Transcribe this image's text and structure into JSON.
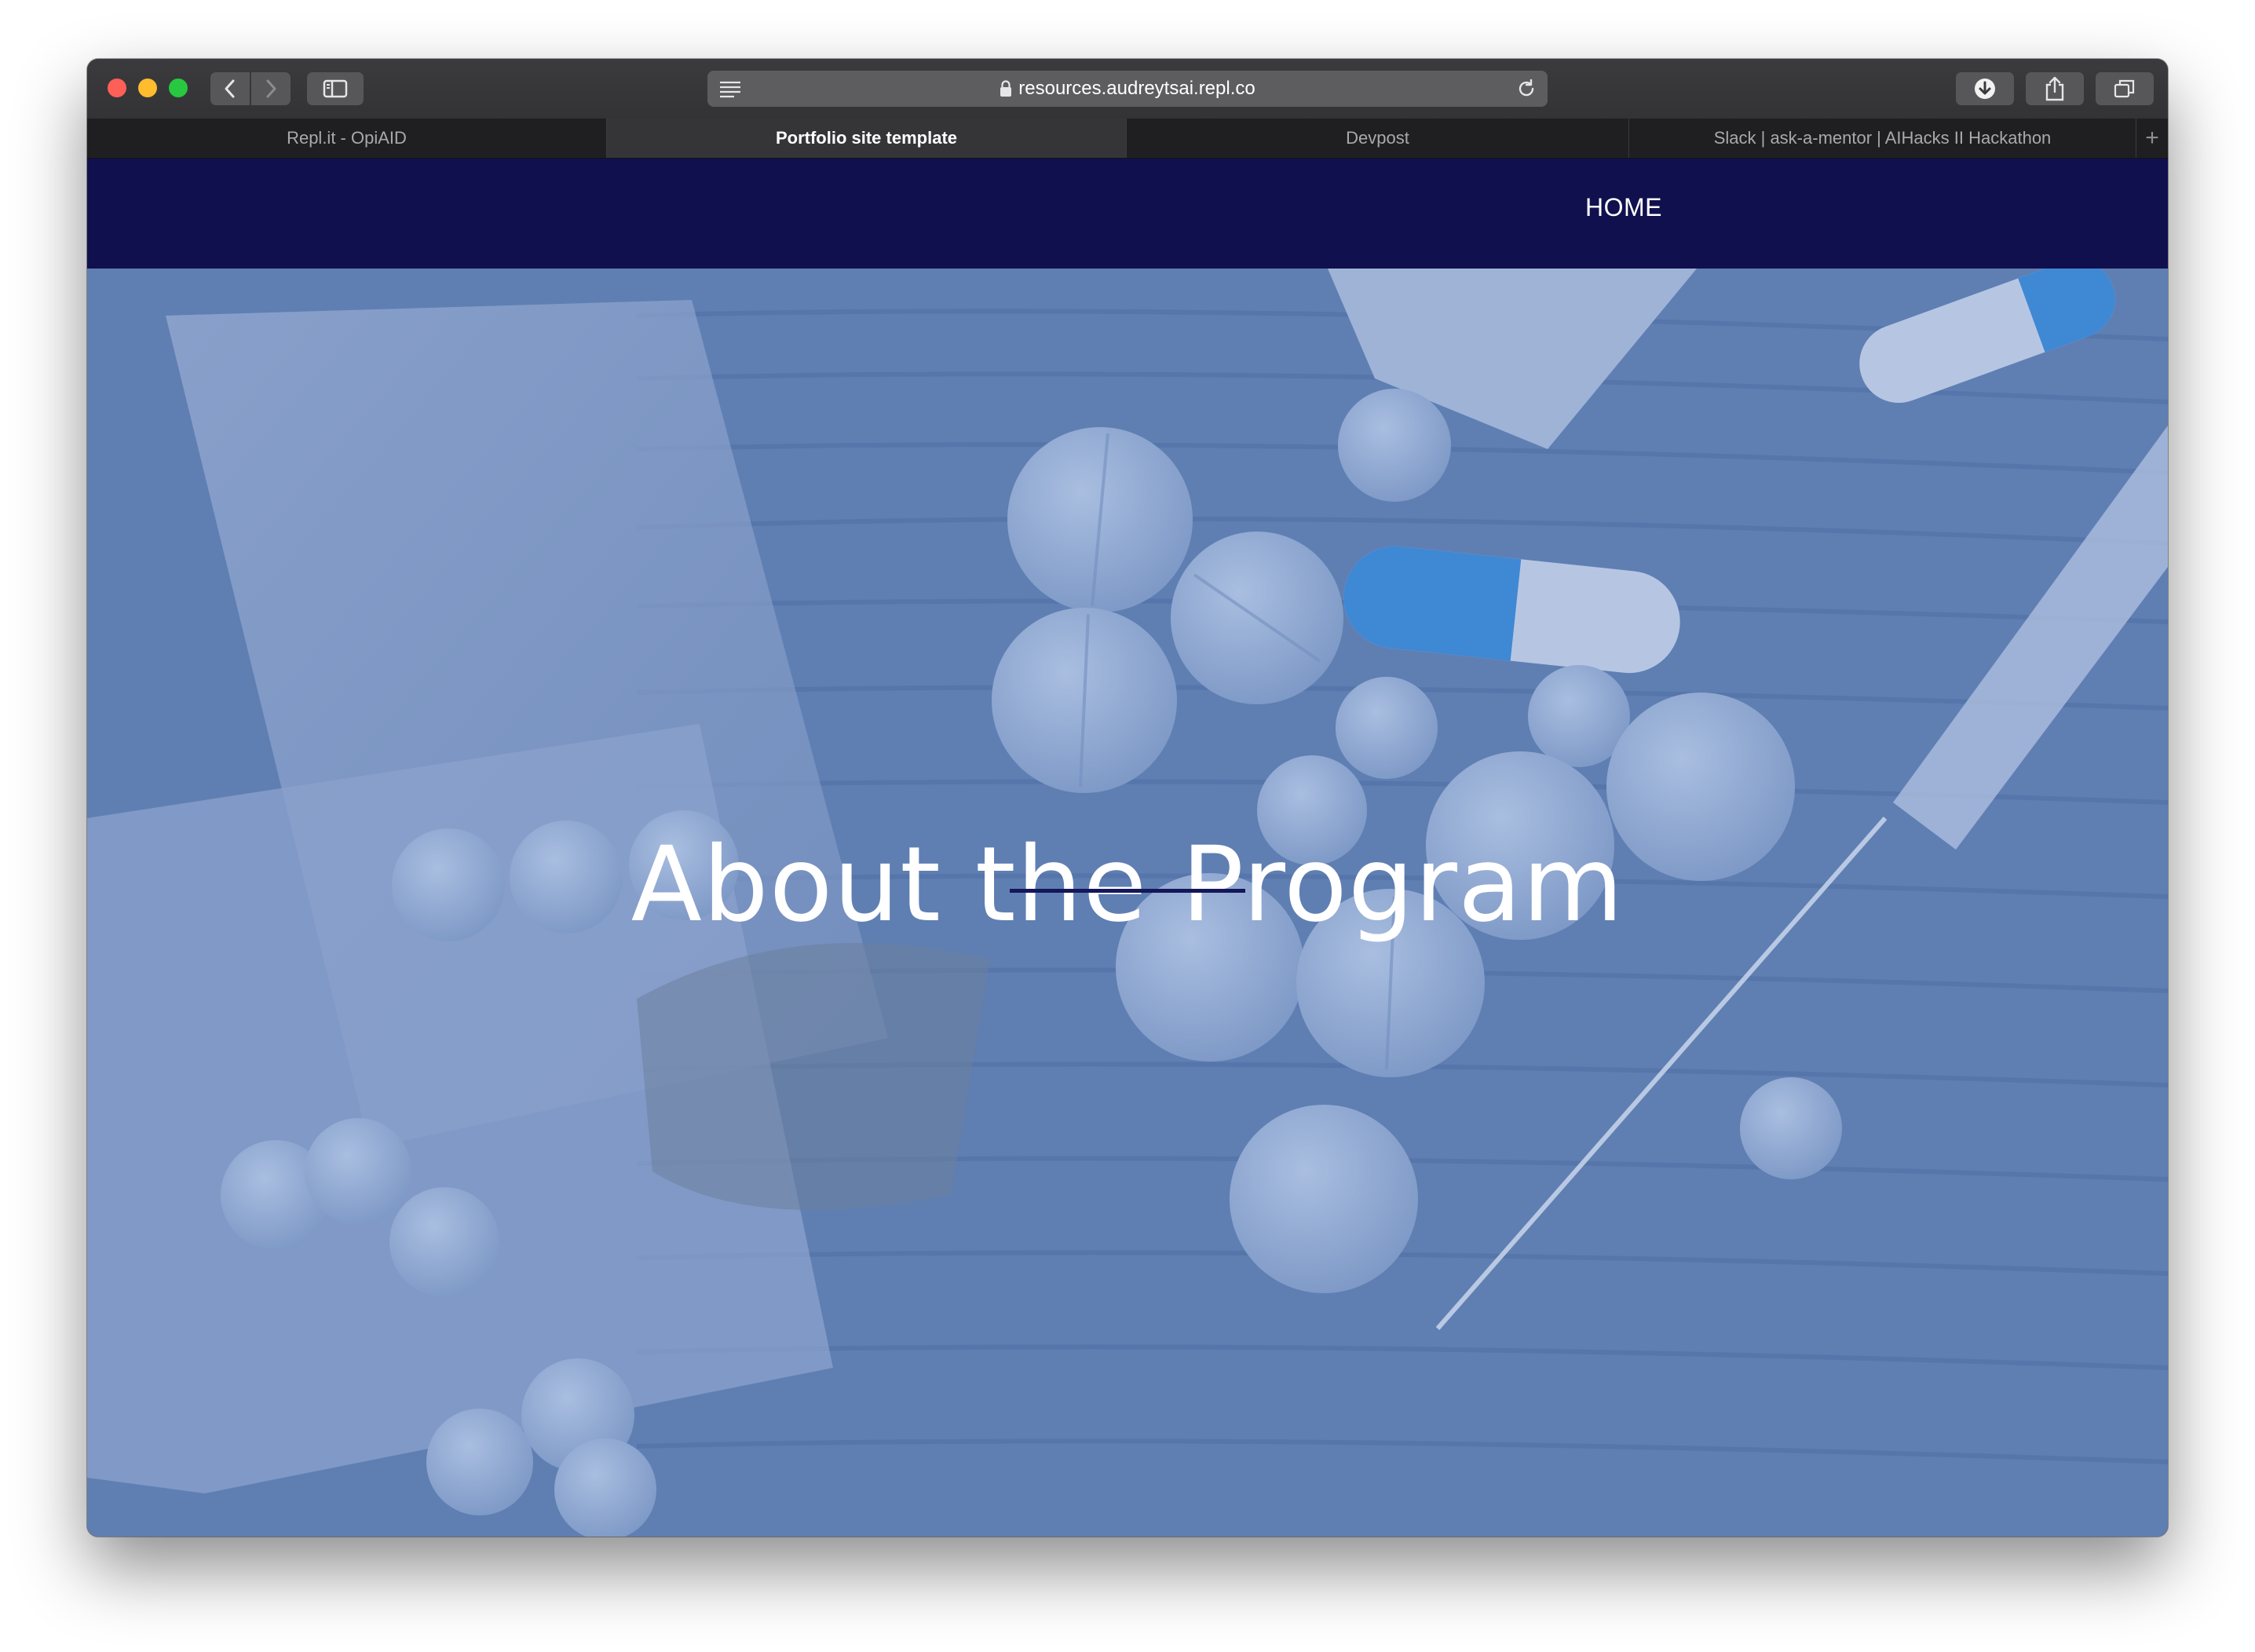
{
  "browser": {
    "url": "resources.audreytsai.repl.co",
    "tabs": [
      {
        "label": "Repl.it - OpiAID",
        "active": false
      },
      {
        "label": "Portfolio site template",
        "active": true
      },
      {
        "label": "Devpost",
        "active": false
      },
      {
        "label": "Slack | ask-a-mentor | AIHacks II Hackathon",
        "active": false
      }
    ],
    "new_tab_glyph": "+",
    "icons": [
      "back-icon",
      "forward-icon",
      "sidebar-icon",
      "reader-icon",
      "lock-icon",
      "reload-icon",
      "download-icon",
      "share-icon",
      "tabs-overview-icon"
    ]
  },
  "site": {
    "nav": {
      "home_label": "HOME"
    },
    "hero": {
      "title": "About the Program"
    },
    "colors": {
      "navbar": "#10104f",
      "hero_overlay": "#5f7fb3",
      "underline": "#15175a"
    }
  }
}
